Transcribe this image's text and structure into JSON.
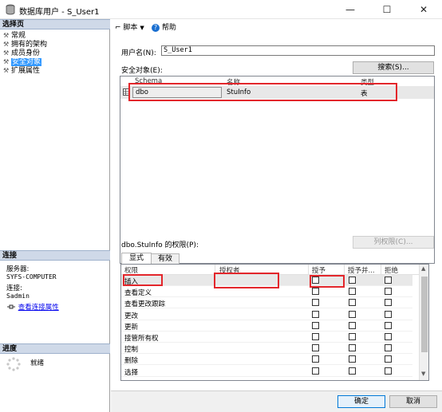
{
  "window": {
    "title": "数据库用户 - S_User1",
    "minimize": "—",
    "maximize": "☐",
    "close": "✕"
  },
  "left_panel": {
    "select_page_header": "选择页",
    "nav_items": [
      {
        "label": "常规",
        "icon": "wrench-icon",
        "selected": false
      },
      {
        "label": "拥有的架构",
        "icon": "wrench-icon",
        "selected": false
      },
      {
        "label": "成员身份",
        "icon": "wrench-icon",
        "selected": false
      },
      {
        "label": "安全对象",
        "icon": "wrench-icon",
        "selected": true
      },
      {
        "label": "扩展属性",
        "icon": "wrench-icon",
        "selected": false
      }
    ],
    "connection_header": "连接",
    "server_label": "服务器:",
    "server_value": "SYFS-COMPUTER",
    "connection_label": "连接:",
    "connection_value": "Sadmin",
    "view_conn_props": "查看连接属性",
    "progress_header": "进度",
    "progress_status": "就绪"
  },
  "toolbar": {
    "script_label": "脚本",
    "help_label": "帮助"
  },
  "form": {
    "username_label": "用户名(N):",
    "username_value": "S_User1",
    "securables_label": "安全对象(E):",
    "search_button": "搜索(S)...",
    "securables_columns": [
      "Schema",
      "名称",
      "类型"
    ],
    "securables_rows": [
      {
        "schema": "dbo",
        "name": "StuInfo",
        "type": "表"
      }
    ],
    "permissions_label": "dbo.StuInfo 的权限(P):",
    "column_permissions_button": "列权限(C)...",
    "tabs": [
      "显式",
      "有效"
    ],
    "perm_columns": [
      "权限",
      "授权者",
      "授予",
      "授予并...",
      "拒绝"
    ],
    "perm_rows": [
      {
        "permission": "插入",
        "grantor": "",
        "grant": false,
        "with_grant": false,
        "deny": false
      },
      {
        "permission": "查看定义",
        "grantor": "",
        "grant": false,
        "with_grant": false,
        "deny": false
      },
      {
        "permission": "查看更改跟踪",
        "grantor": "",
        "grant": false,
        "with_grant": false,
        "deny": false
      },
      {
        "permission": "更改",
        "grantor": "",
        "grant": false,
        "with_grant": false,
        "deny": false
      },
      {
        "permission": "更新",
        "grantor": "",
        "grant": false,
        "with_grant": false,
        "deny": false
      },
      {
        "permission": "接管所有权",
        "grantor": "",
        "grant": false,
        "with_grant": false,
        "deny": false
      },
      {
        "permission": "控制",
        "grantor": "",
        "grant": false,
        "with_grant": false,
        "deny": false
      },
      {
        "permission": "删除",
        "grantor": "",
        "grant": false,
        "with_grant": false,
        "deny": false
      },
      {
        "permission": "选择",
        "grantor": "",
        "grant": false,
        "with_grant": false,
        "deny": false
      }
    ]
  },
  "footer": {
    "ok_button": "确定",
    "cancel_button": "取消"
  },
  "colors": {
    "selection": "#3399ff",
    "highlight_box": "#e3262b",
    "section_header": "#cfd9e8"
  }
}
